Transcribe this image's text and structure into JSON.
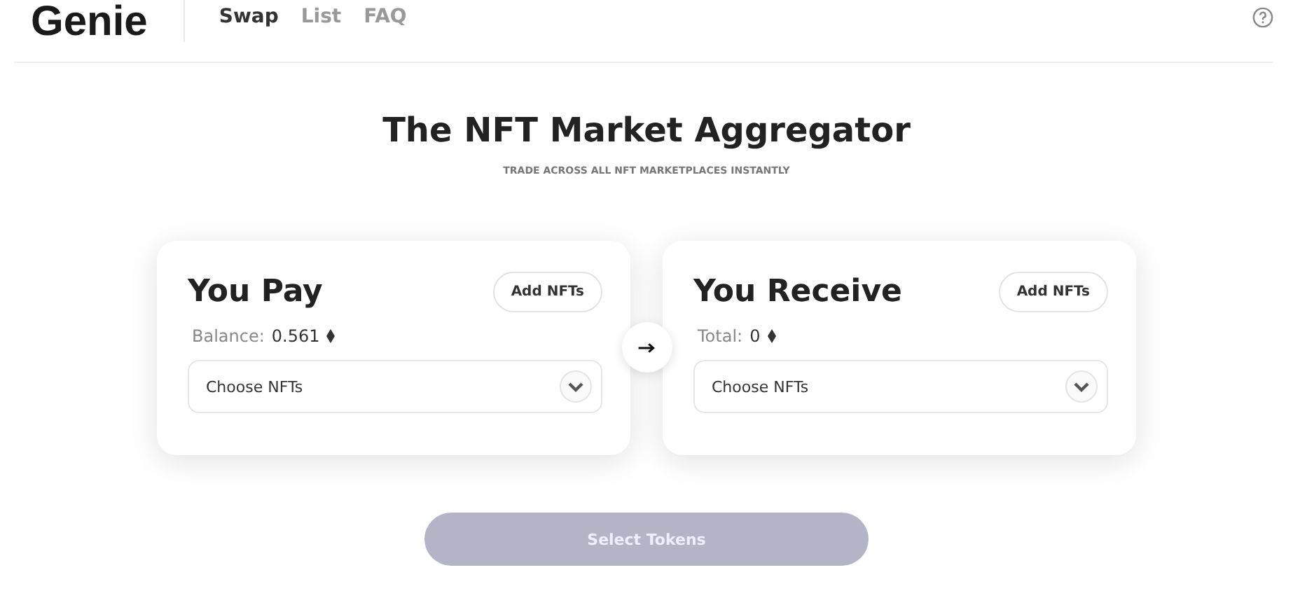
{
  "header": {
    "logo": "Genie",
    "nav": [
      {
        "label": "Swap",
        "selected": true
      },
      {
        "label": "List",
        "selected": false
      },
      {
        "label": "FAQ",
        "selected": false
      }
    ]
  },
  "hero": {
    "title": "The NFT Market Aggregator",
    "subtitle": "TRADE ACROSS ALL NFT MARKETPLACES INSTANTLY"
  },
  "cards": [
    {
      "title": "You Pay",
      "button": "Add NFTs",
      "label": "Balance:",
      "amount": "0.561",
      "select": "Choose NFTs"
    },
    {
      "title": "You Receive",
      "button": "Add NFTs",
      "label": "Total:",
      "amount": "0",
      "select": "Choose NFTs"
    }
  ],
  "action": {
    "label": "Select Tokens",
    "disabled": true
  }
}
